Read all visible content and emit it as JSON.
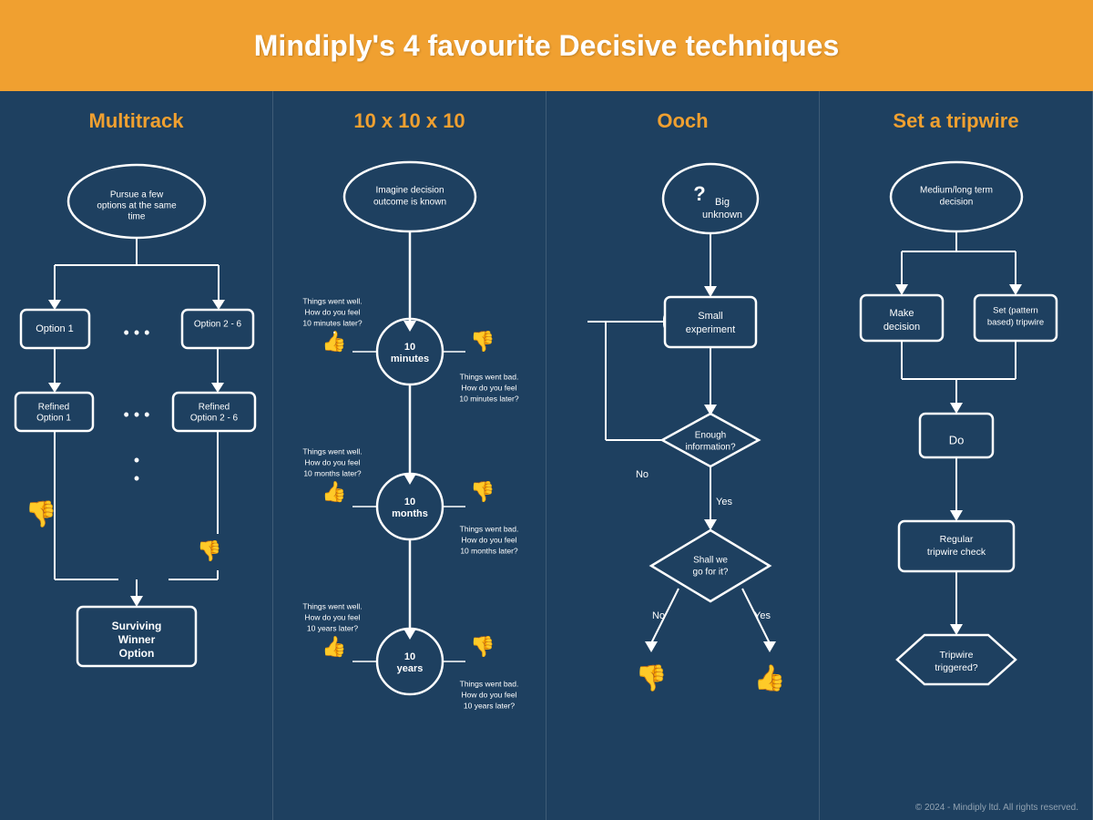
{
  "header": {
    "title": "Mindiply's 4 favourite Decisive techniques"
  },
  "multitrack": {
    "title": "Multitrack",
    "top_label": "Pursue a few options at the same time",
    "option1": "Option 1",
    "option2": "Option 2 - 6",
    "refined1": "Refined Option 1",
    "refined2": "Refined Option 2 - 6",
    "winner": "Surviving Winner Option",
    "dots": "..."
  },
  "tenx": {
    "title": "10 x 10 x 10",
    "top_label": "Imagine decision outcome is known",
    "min10_label": "10 minutes",
    "mon10_label": "10 months",
    "yr10_label": "10 years",
    "well1": "Things went well. How do you feel 10 minutes later?",
    "bad1": "Things went bad. How do you feel 10 minutes later?",
    "well2": "Things went well. How do you feel 10 months later?",
    "bad2": "Things went bad. How do you feel 10 months later?",
    "well3": "Things went well. How do you feel 10 years later?",
    "bad3": "Things went bad. How do you feel 10 years later?"
  },
  "ooch": {
    "title": "Ooch",
    "unknown": "Big unknown",
    "experiment": "Small experiment",
    "enough": "Enough information?",
    "go": "Shall we go for it?",
    "yes": "Yes",
    "no": "No"
  },
  "tripwire": {
    "title": "Set a tripwire",
    "decision_label": "Medium/long term decision",
    "make_decision": "Make decision",
    "set_tripwire": "Set (pattern based) tripwire",
    "do_label": "Do",
    "regular_check": "Regular tripwire check",
    "triggered": "Tripwire triggered?"
  },
  "footer": {
    "text": "© 2024 - Mindiply ltd. All rights reserved."
  }
}
